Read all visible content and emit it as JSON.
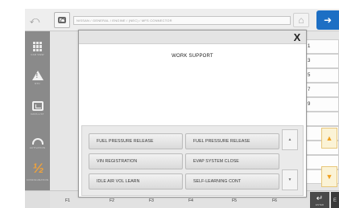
{
  "topbar": {
    "breadcrumb": "NISSAN / GENERAL / ENGINE / (NEC) / MFS CONNECTOR",
    "back_icon": "back-arrow-icon",
    "camera_icon": "camera-icon",
    "home_icon": "home-icon",
    "blue_button_icon": "arrow-icon"
  },
  "sidebar": {
    "items": [
      {
        "icon": "grid-icon",
        "caption": "CAR VIEW"
      },
      {
        "icon": "warning-icon",
        "caption": "DTC"
      },
      {
        "icon": "chart-icon",
        "caption": "DATA LIST"
      },
      {
        "icon": "gauge-icon",
        "caption": "ACTIVATION"
      },
      {
        "icon": "fraction-icon",
        "caption": "CONFIGURATION"
      }
    ]
  },
  "background_rows": [
    "1",
    "3",
    "5",
    "7",
    "9",
    "",
    "",
    "",
    "",
    ""
  ],
  "dialog": {
    "close_label": "X",
    "title": "WORK SUPPORT",
    "buttons": [
      "FUEL PRESSURE RELEASE",
      "FUEL PRESSURE RELEASE",
      "VIN REGISTRATION",
      "EVAP SYSTEM CLOSE",
      "IDLE AIR VOL LEARN",
      "SELF-LEARNING CONT"
    ],
    "scroll_up": "▲",
    "scroll_down": "▼"
  },
  "function_keys": [
    "F1",
    "F2",
    "F3",
    "F4",
    "F5",
    "F6"
  ],
  "enter_key": {
    "label": "↵",
    "caption": "ENTER"
  },
  "extra_key": "E",
  "colors": {
    "accent_blue": "#1d6fc4",
    "sidebar_gray": "#8a8a8a",
    "scroll_orange": "#f0a020"
  }
}
